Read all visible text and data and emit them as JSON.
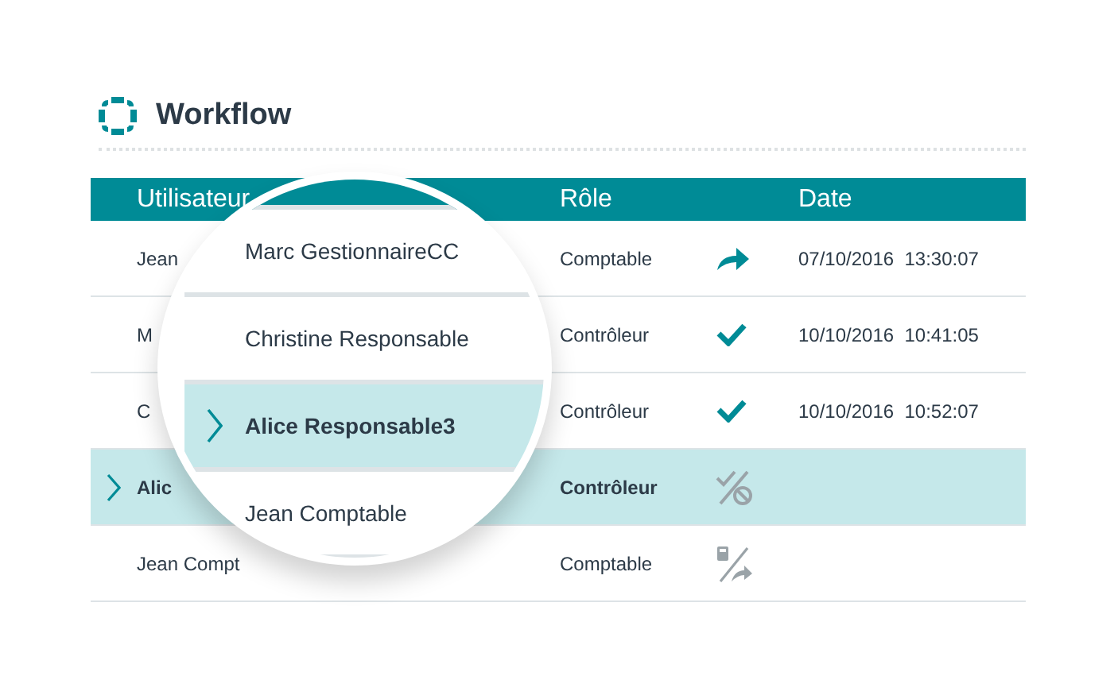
{
  "title": "Workflow",
  "table": {
    "columns": [
      "Utilisateur",
      "Rôle",
      "Date"
    ],
    "rows": [
      {
        "user": "Jean",
        "role": "Comptable",
        "status": {
          "kind": "forwarded"
        },
        "date": "07/10/2016  13:30:07",
        "selected": false
      },
      {
        "user": "M",
        "role": "Contrôleur",
        "status": {
          "kind": "approved"
        },
        "date": "10/10/2016  10:41:05",
        "selected": false
      },
      {
        "user": "C",
        "role": "Contrôleur",
        "status": {
          "kind": "approved"
        },
        "date": "10/10/2016  10:52:07",
        "selected": false
      },
      {
        "user": "Alic",
        "role": "Contrôleur",
        "status": {
          "kind": "refused"
        },
        "selected": true
      },
      {
        "user": "Jean Compt",
        "role": "Comptable",
        "status": {
          "kind": "pending"
        },
        "selected": false
      }
    ]
  },
  "magnifier": {
    "rows": [
      {
        "name": "Marc GestionnaireCC",
        "selected": false
      },
      {
        "name": "Christine Responsable",
        "selected": false
      },
      {
        "name": "Alice Responsable3",
        "selected": true
      },
      {
        "name": "Jean Comptable",
        "selected": false
      }
    ]
  }
}
